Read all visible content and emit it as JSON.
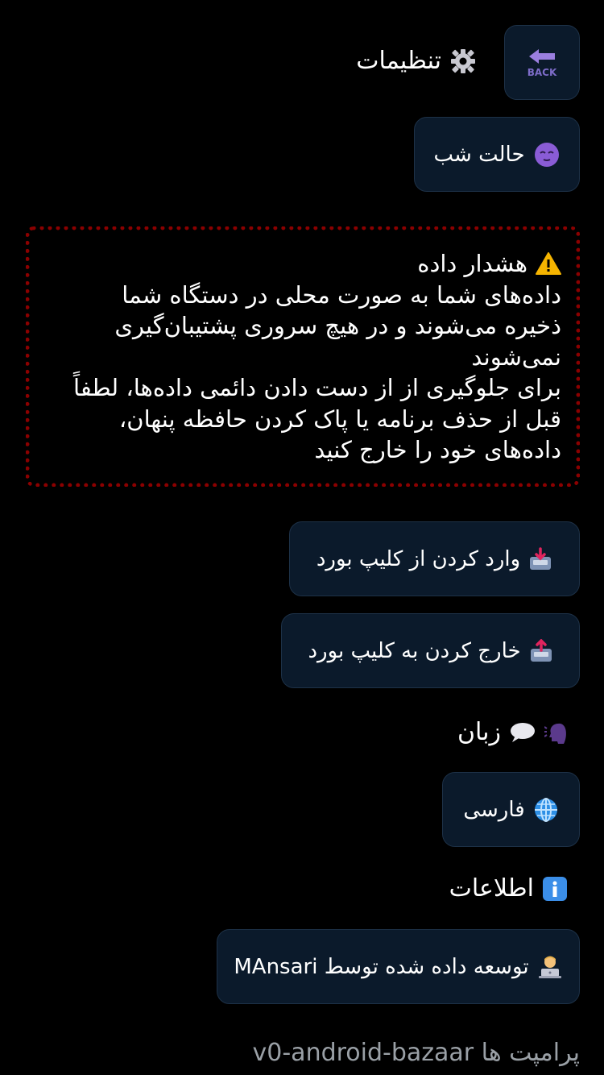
{
  "header": {
    "title": "تنظیمات",
    "back_label": "BACK"
  },
  "night_mode": {
    "label": "حالت شب"
  },
  "warning": {
    "title": "هشدار داده",
    "lines": [
      "داده‌های شما به صورت محلی در دستگاه شما",
      "ذخیره می‌شوند و در هیچ سروری پشتیبان‌گیری",
      "نمی‌شوند",
      "برای جلوگیری از از دست دادن دائمی داده‌ها، لطفاً",
      "قبل از حذف برنامه یا پاک کردن حافظه پنهان،",
      "داده‌های خود را خارج کنید"
    ]
  },
  "data_actions": {
    "import_label": "وارد کردن از کلیپ بورد",
    "export_label": "خارج کردن به کلیپ بورد"
  },
  "language": {
    "heading": "زبان",
    "current": "فارسی"
  },
  "info": {
    "heading": "اطلاعات",
    "developer": "توسعه داده شده توسط MAnsari"
  },
  "footer": {
    "text": "پرامپت ها v0-android-bazaar"
  },
  "colors": {
    "background": "#000000",
    "button_bg": "#0b1a2b",
    "warning_border": "#8b0000",
    "footer_text": "#9aa0a6"
  }
}
